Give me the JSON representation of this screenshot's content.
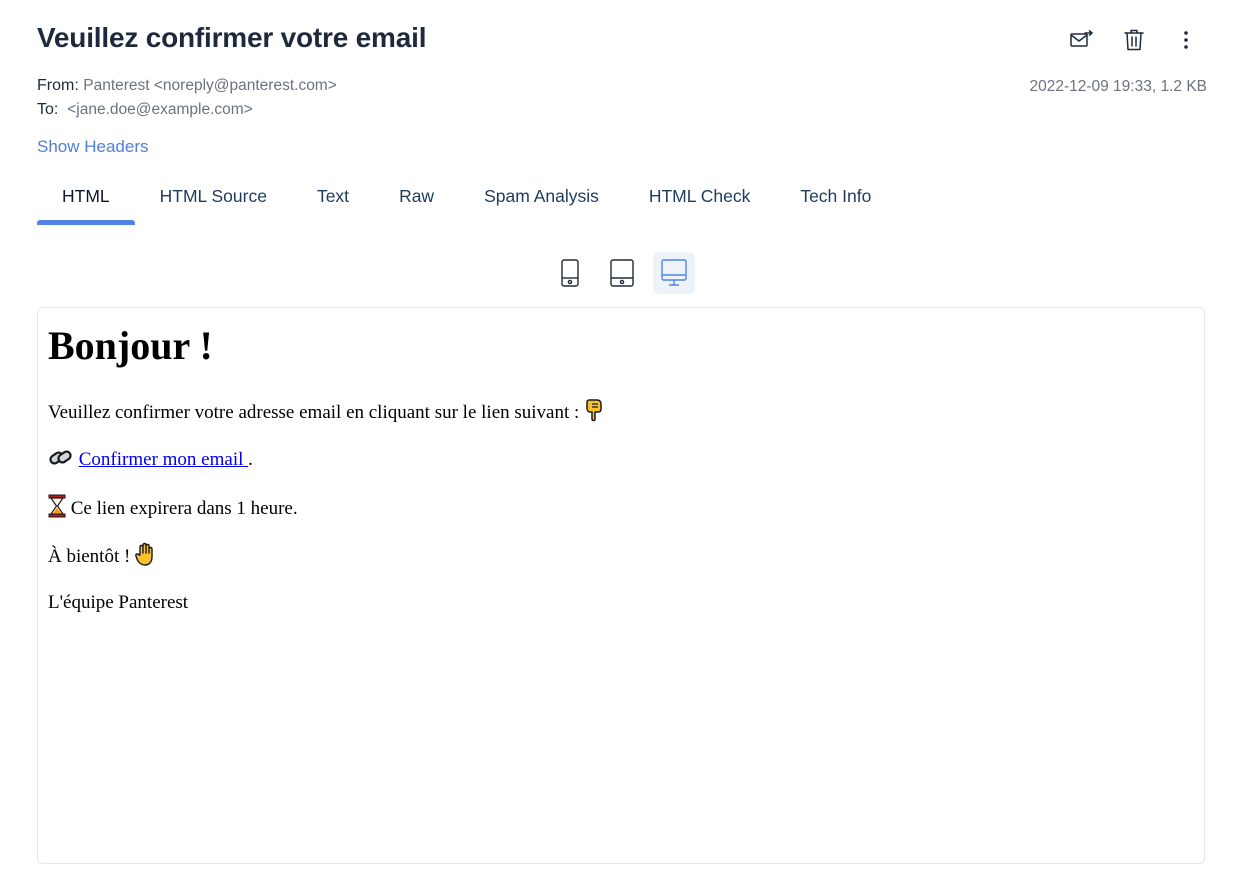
{
  "email": {
    "subject": "Veuillez confirmer votre email",
    "from_label": "From:",
    "from_value": "Panterest <noreply@panterest.com>",
    "to_label": "To:",
    "to_value": "<jane.doe@example.com>",
    "meta": "2022-12-09 19:33, 1.2 KB",
    "show_headers": "Show Headers"
  },
  "actions": [
    {
      "icon": "forward-mail-icon"
    },
    {
      "icon": "trash-icon"
    },
    {
      "icon": "more-vertical-icon"
    }
  ],
  "tabs": [
    {
      "label": "HTML",
      "active": true
    },
    {
      "label": "HTML Source"
    },
    {
      "label": "Text"
    },
    {
      "label": "Raw"
    },
    {
      "label": "Spam Analysis"
    },
    {
      "label": "HTML Check"
    },
    {
      "label": "Tech Info"
    }
  ],
  "view_modes": [
    {
      "icon": "mobile-icon"
    },
    {
      "icon": "tablet-icon"
    },
    {
      "icon": "desktop-icon",
      "active": true
    }
  ],
  "preview": {
    "heading": "Bonjour !",
    "line1": "Veuillez confirmer votre adresse email en cliquant sur le lien suivant :",
    "link_text": "Confirmer mon email ",
    "link_suffix": ".",
    "line3": "Ce lien expirera dans 1 heure.",
    "line4": "À bientôt !",
    "signature": "L'équipe Panterest"
  },
  "colors": {
    "accent": "#4f83e6",
    "link_blue": "#4f7fdb",
    "muted": "#6b7280",
    "title": "#1e2a3b"
  }
}
